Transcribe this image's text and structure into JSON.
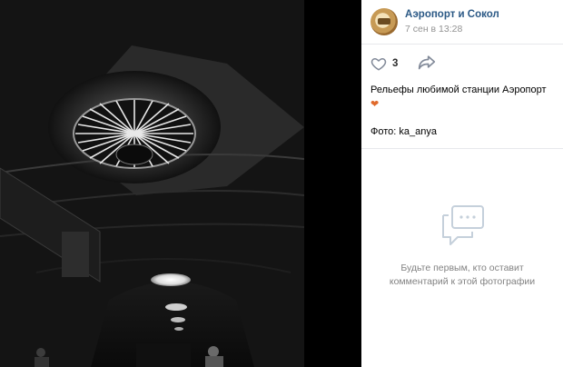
{
  "post": {
    "author": "Аэропорт и Сокол",
    "date": "7 сен в 13:28",
    "likes": "3",
    "text": "Рельефы любимой станции Аэропорт",
    "credit": "Фото: ka_anya"
  },
  "comments": {
    "empty_line1": "Будьте первым, кто оставит",
    "empty_line2": "комментарий к этой фотографии"
  },
  "icons": {
    "like": "heart-icon",
    "share": "share-arrow-icon",
    "emoji": "orange-heart-icon",
    "empty": "comments-icon"
  },
  "colors": {
    "author_link": "#2a5885",
    "muted": "#939393",
    "emoji_heart": "#e06a2c"
  }
}
